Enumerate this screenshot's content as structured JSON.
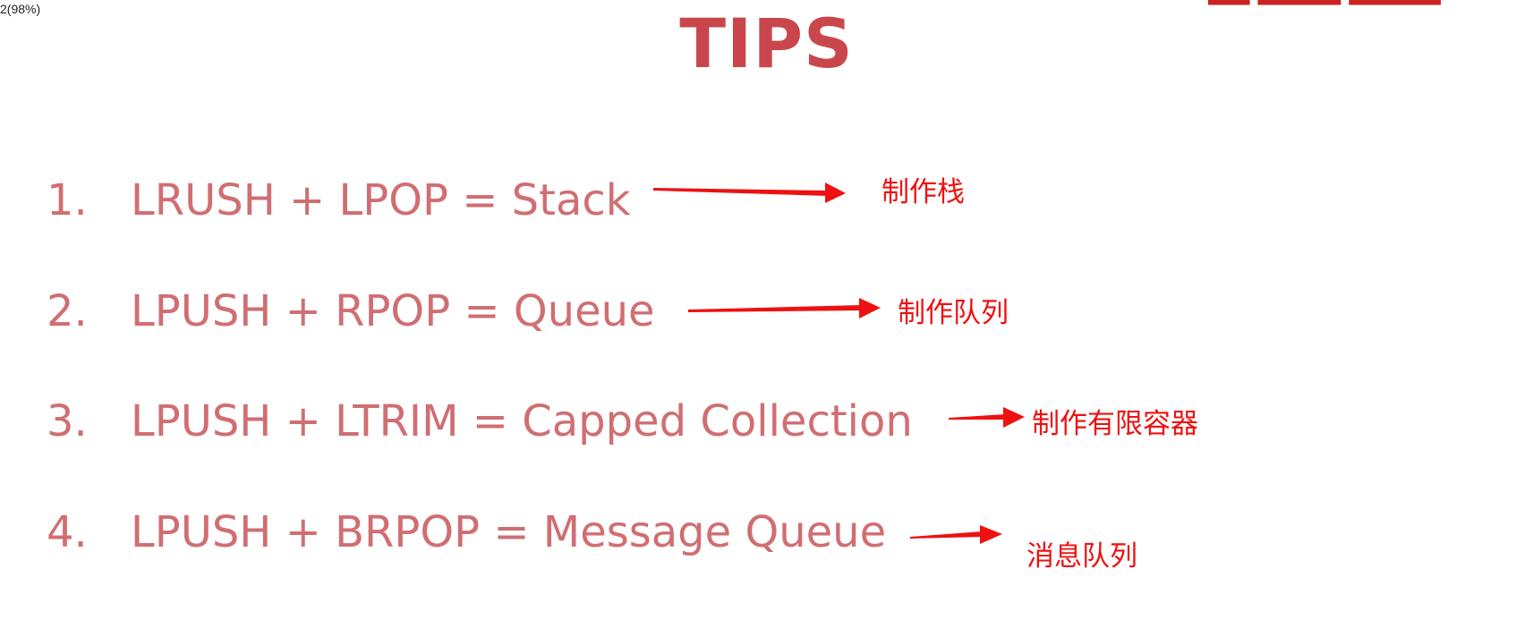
{
  "zoom_indicator": "2(98%)",
  "header": {
    "title": "TIPS"
  },
  "tips": [
    {
      "number": "1.",
      "text": "LRUSH + LPOP = Stack",
      "note": "制作栈"
    },
    {
      "number": "2.",
      "text": "LPUSH + RPOP = Queue",
      "note": "制作队列"
    },
    {
      "number": "3.",
      "text": "LPUSH + LTRIM = Capped Collection",
      "note": "制作有限容器"
    },
    {
      "number": "4.",
      "text": "LPUSH + BRPOP = Message Queue",
      "note": "消息队列"
    }
  ],
  "colors": {
    "title": "#c9474c",
    "tip_text": "#d06e72",
    "annotation": "#ee1111"
  }
}
